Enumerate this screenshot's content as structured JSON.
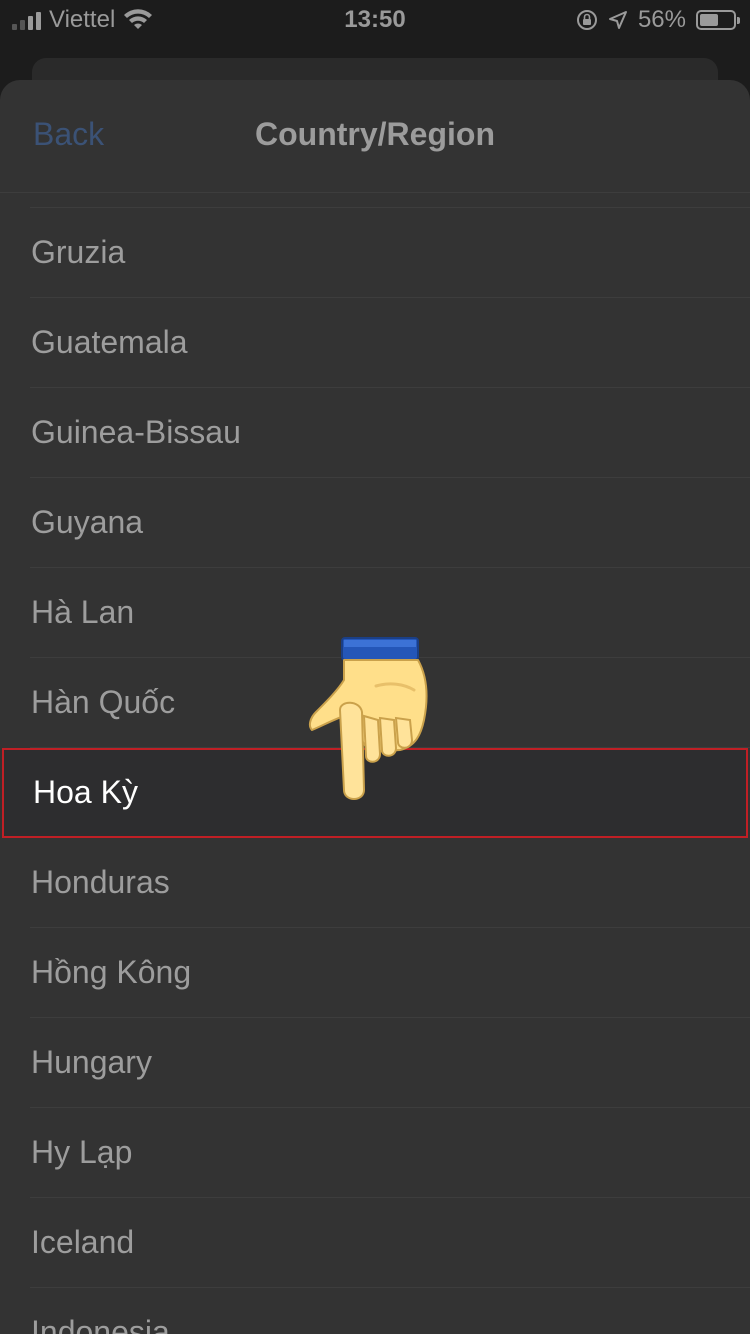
{
  "status_bar": {
    "carrier": "Viettel",
    "time": "13:50",
    "battery": "56%",
    "battery_level": 0.56
  },
  "nav": {
    "back_label": "Back",
    "title": "Country/Region"
  },
  "countries": [
    "Gruzia",
    "Guatemala",
    "Guinea-Bissau",
    "Guyana",
    "Hà Lan",
    "Hàn Quốc",
    "Hoa Kỳ",
    "Honduras",
    "Hồng Kông",
    "Hungary",
    "Hy Lạp",
    "Iceland",
    "Indonesia"
  ],
  "highlighted_country": "Hoa Kỳ",
  "icons": {
    "signal": "signal-icon",
    "wifi": "wifi-icon",
    "orientation_lock": "orientation-lock-icon",
    "location": "location-arrow-icon",
    "battery": "battery-icon",
    "pointer": "pointing-hand-icon"
  },
  "colors": {
    "sheet_bg": "#333333",
    "highlight_border": "#c01f25",
    "back_link": "#3b5276"
  }
}
